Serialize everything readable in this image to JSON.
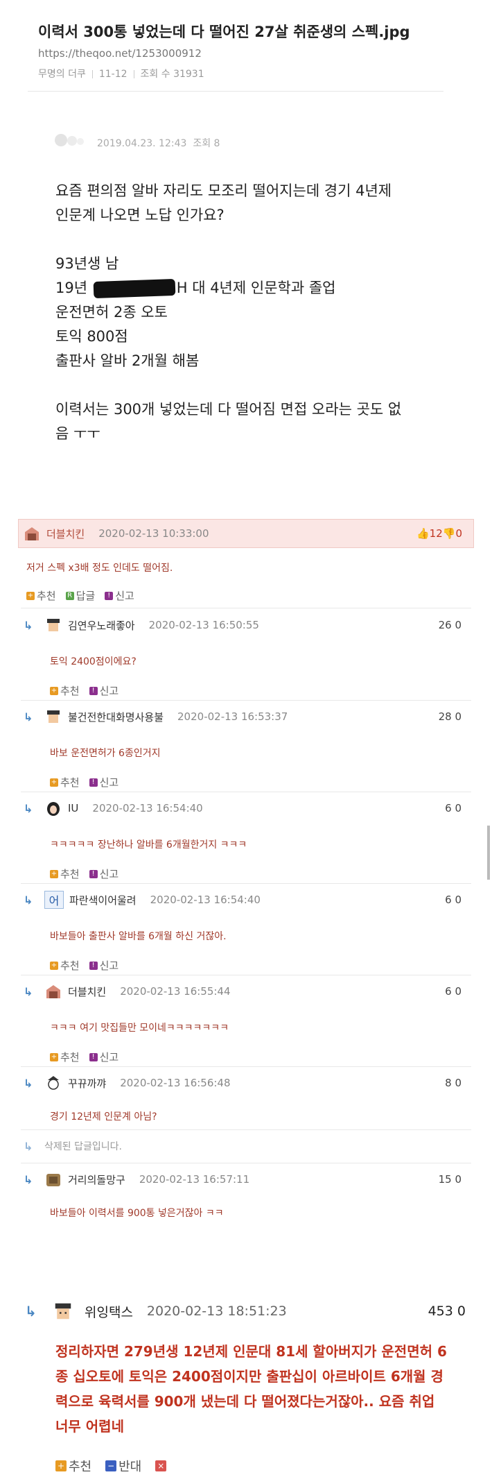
{
  "header": {
    "title": "이력서 300통 넣었는데 다 떨어진 27살 취준생의 스펙.jpg",
    "url": "https://theqoo.net/1253000912",
    "author": "무명의 더쿠",
    "date": "11-12",
    "views": "조회 수 31931"
  },
  "post": {
    "datetime": "2019.04.23. 12:43",
    "views": "조회 8",
    "lines": {
      "l1": "요즘 편의점 알바 자리도 모조리 떨어지는데 경기 4년제",
      "l2": "인문계 나오면 노답 인가요?",
      "l3": "93년생 남",
      "l4a": "19년",
      "l4b": "H 대 4년제 인문학과 졸업",
      "l5": "운전면허 2종 오토",
      "l6": "토익 800점",
      "l7": "출판사 알바 2개월 해봄",
      "l8": "이력서는 300개 넣었는데 다 떨어짐 면접 오라는 곳도 없",
      "l9": "음 ㅜㅜ"
    }
  },
  "labels": {
    "recommend": "추천",
    "reply": "답글",
    "report": "신고",
    "oppose": "반대"
  },
  "top_comment": {
    "nick": "더블치킨",
    "date": "2020-02-13 10:33:00",
    "likes": "12",
    "dislikes": "0",
    "text": "저거 스펙 x3배 정도 인데도 떨어짐."
  },
  "replies": [
    {
      "nick": "김연우노래좋아",
      "date": "2020-02-13 16:50:55",
      "score": "26 0",
      "text": "토익 2400점이에요?"
    },
    {
      "nick": "불건전한대화명사용불",
      "date": "2020-02-13 16:53:37",
      "score": "28 0",
      "text": "바보 운전면허가 6종인거지"
    },
    {
      "nick": "IU",
      "date": "2020-02-13 16:54:40",
      "score": "6 0",
      "text": "ㅋㅋㅋㅋㅋ 장난하나 알바를 6개월한거지 ㅋㅋㅋ"
    },
    {
      "nick": "파란색이어울려",
      "date": "2020-02-13 16:54:40",
      "score": "6 0",
      "text": "바보들아 출판사 알바를 6개월 하신 거잖아."
    },
    {
      "nick": "더블치킨",
      "date": "2020-02-13 16:55:44",
      "score": "6 0",
      "text": "ㅋㅋㅋ 여기 맛집들만 모이네ㅋㅋㅋㅋㅋㅋㅋ"
    },
    {
      "nick": "꾸뀨까꺄",
      "date": "2020-02-13 16:56:48",
      "score": "8 0",
      "text": "경기 12년제 인문계 아님?"
    }
  ],
  "deleted": "삭제된 답글입니다.",
  "last_reply": {
    "nick": "거리의돌망구",
    "date": "2020-02-13 16:57:11",
    "score": "15 0",
    "text": "바보들아 이력서를 900통 넣은거잖아 ㅋㅋ"
  },
  "final": {
    "nick": "위잉택스",
    "date": "2020-02-13 18:51:23",
    "score": "453 0",
    "l1": "정리하자면 279년생 12년제 인문대 81세 할아버지가 운전면허 6",
    "l2": "종 십오토에 토익은 2400점이지만 출판십이 아르바이트 6개월 경",
    "l3": "력으로 육력서를 900개 냈는데 다 떨어졌다는거잖아.. 요즘 취업",
    "l4": "너무 어렵네"
  },
  "colors": {
    "comment_text": "#a0392a",
    "final_text": "#c0331f",
    "reply_arrow": "#4a87c2",
    "top_comment_bg": "#fbe6e4",
    "recommend_icon": "#e79a22",
    "reply_icon": "#5aa34a",
    "report_icon": "#8b2f8d",
    "oppose_icon": "#3a5fc0"
  }
}
